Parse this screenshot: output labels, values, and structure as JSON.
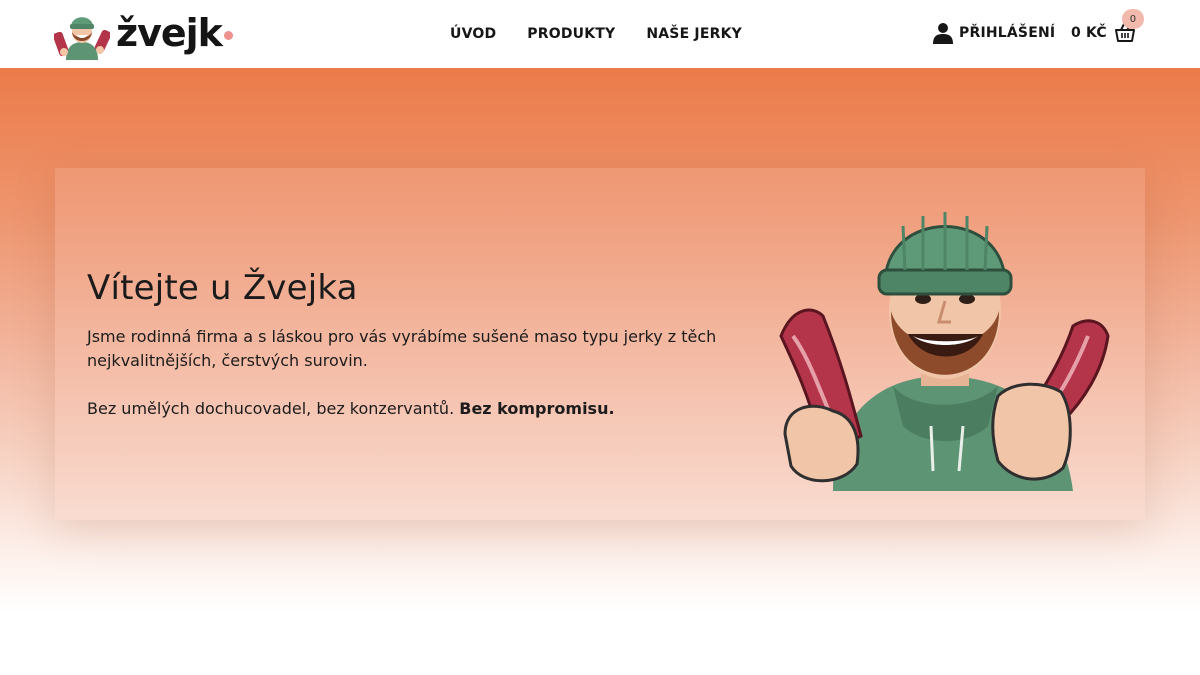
{
  "header": {
    "logo_text": "žvejk",
    "nav": [
      {
        "label": "ÚVOD"
      },
      {
        "label": "PRODUKTY"
      },
      {
        "label": "NAŠE JERKY"
      }
    ],
    "login_label": "PŘIHLÁŠENÍ",
    "cart_total": "0 KČ",
    "cart_count": "0"
  },
  "hero": {
    "title": "Vítejte u Žvejka",
    "paragraph": "Jsme rodinná firma a s láskou pro vás vyrábíme sušené maso typu jerky z těch nejkvalitnějších, čerstvých surovin.",
    "paragraph2_prefix": "Bez umělých dochucovadel, bez konzervantů.",
    "paragraph2_bold": "Bez kompromisu."
  },
  "colors": {
    "accent": "#ec7b49",
    "logo_dot": "#ef8f8e",
    "badge": "#f2b9ad",
    "beanie": "#5f9a78"
  },
  "icons": {
    "login": "user-icon",
    "cart": "basket-icon",
    "logo": "man-with-jerky-avatar"
  }
}
